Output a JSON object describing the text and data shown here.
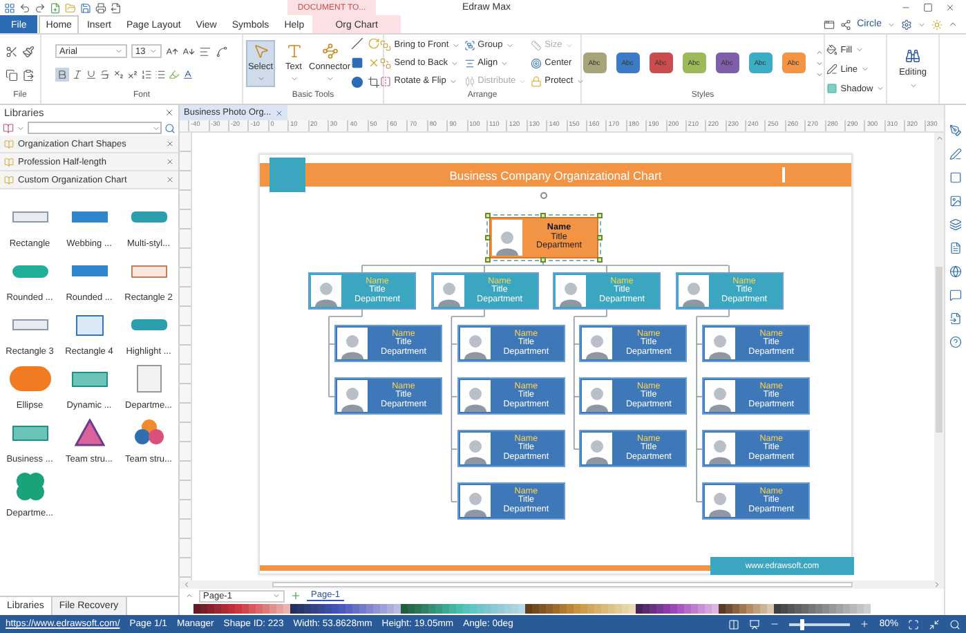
{
  "title_bar": {
    "context_label": "DOCUMENT TO...",
    "title": "Edraw Max"
  },
  "tabs": [
    {
      "label": "File",
      "kind": "file",
      "selected": false
    },
    {
      "label": "Home",
      "kind": "tab",
      "selected": true
    },
    {
      "label": "Insert",
      "kind": "tab",
      "selected": false
    },
    {
      "label": "Page Layout",
      "kind": "tab",
      "selected": false
    },
    {
      "label": "View",
      "kind": "tab",
      "selected": false
    },
    {
      "label": "Symbols",
      "kind": "tab",
      "selected": false
    },
    {
      "label": "Help",
      "kind": "tab",
      "selected": false
    },
    {
      "label": "Org Chart",
      "kind": "context",
      "selected": false
    }
  ],
  "account": {
    "label": "Circle"
  },
  "ribbon": {
    "file": {
      "label": "File"
    },
    "font": {
      "label": "Font",
      "family": "Arial",
      "size": "13",
      "bold": true
    },
    "tools": {
      "label": "Basic Tools",
      "items": [
        {
          "label": "Select",
          "selected": true
        },
        {
          "label": "Text",
          "selected": false
        },
        {
          "label": "Connector",
          "selected": false
        }
      ]
    },
    "arrange": {
      "label": "Arrange",
      "items": [
        {
          "label": "Bring to Front",
          "disabled": false,
          "menu": true
        },
        {
          "label": "Send to Back",
          "disabled": false,
          "menu": true
        },
        {
          "label": "Rotate & Flip",
          "disabled": false,
          "menu": true
        },
        {
          "label": "Group",
          "disabled": false,
          "menu": true
        },
        {
          "label": "Align",
          "disabled": false,
          "menu": true
        },
        {
          "label": "Distribute",
          "disabled": true,
          "menu": true
        },
        {
          "label": "Size",
          "disabled": true,
          "menu": true
        },
        {
          "label": "Center",
          "disabled": false,
          "menu": false
        },
        {
          "label": "Protect",
          "disabled": false,
          "menu": true
        }
      ]
    },
    "styles": {
      "label": "Styles",
      "items": [
        {
          "label": "Abc",
          "color": "#a8a47a"
        },
        {
          "label": "Abc",
          "color": "#3d7cc4"
        },
        {
          "label": "Abc",
          "color": "#c94d4d"
        },
        {
          "label": "Abc",
          "color": "#9cba5a"
        },
        {
          "label": "Abc",
          "color": "#7d60a9"
        },
        {
          "label": "Abc",
          "color": "#3badc5"
        },
        {
          "label": "Abc",
          "color": "#f29444"
        }
      ]
    },
    "format": [
      {
        "label": "Fill"
      },
      {
        "label": "Line"
      },
      {
        "label": "Shadow"
      }
    ],
    "editing": {
      "label": "Editing"
    }
  },
  "libraries": {
    "title": "Libraries",
    "categories": [
      {
        "label": "Organization Chart Shapes"
      },
      {
        "label": "Profession Half-length"
      },
      {
        "label": "Custom Organization Chart"
      }
    ],
    "shapes": [
      {
        "label": "Rectangle",
        "kind": "plain"
      },
      {
        "label": "Webbing ...",
        "kind": "blue"
      },
      {
        "label": "Multi-styl...",
        "kind": "teal"
      },
      {
        "label": "Rounded ...",
        "kind": "pill"
      },
      {
        "label": "Rounded ...",
        "kind": "blue"
      },
      {
        "label": "Rectangle 2",
        "kind": "peach"
      },
      {
        "label": "Rectangle 3",
        "kind": "plain"
      },
      {
        "label": "Rectangle 4",
        "kind": "card"
      },
      {
        "label": "Highlight ...",
        "kind": "teal"
      },
      {
        "label": "Ellipse",
        "kind": "ellipse"
      },
      {
        "label": "Dynamic ...",
        "kind": "table"
      },
      {
        "label": "Departme...",
        "kind": "sheet"
      },
      {
        "label": "Business ...",
        "kind": "table"
      },
      {
        "label": "Team stru...",
        "kind": "triangle"
      },
      {
        "label": "Team stru...",
        "kind": "circles"
      },
      {
        "label": "Departme...",
        "kind": "clover"
      }
    ],
    "bottom_tabs": [
      {
        "label": "Libraries",
        "selected": true
      },
      {
        "label": "File Recovery",
        "selected": false
      }
    ]
  },
  "document_tabs": [
    {
      "label": "Business Photo Org...",
      "selected": true
    }
  ],
  "ruler": {
    "labels": [
      "-40",
      "-30",
      "-20",
      "-10",
      "0",
      "10",
      "20",
      "30",
      "40",
      "50",
      "60",
      "70",
      "80",
      "90",
      "100",
      "110",
      "120",
      "130",
      "140",
      "150",
      "160",
      "170",
      "180",
      "190",
      "200",
      "210",
      "220",
      "230",
      "240",
      "250",
      "260",
      "270",
      "280",
      "290",
      "300",
      "310",
      "320",
      "330"
    ]
  },
  "chart": {
    "title": "Business Company Organizational Chart",
    "footer": "www.edrawsoft.com",
    "root": {
      "name": "Name",
      "title": "Title",
      "department": "Department",
      "selected": true,
      "children": [
        {
          "name": "Name",
          "title": "Title",
          "department": "Department",
          "selected": false,
          "children": [
            {
              "name": "Name",
              "title": "Title",
              "department": "Department",
              "selected": false
            },
            {
              "name": "Name",
              "title": "Title",
              "department": "Department",
              "selected": false
            }
          ]
        },
        {
          "name": "Name",
          "title": "Title",
          "department": "Department",
          "selected": false,
          "children": [
            {
              "name": "Name",
              "title": "Title",
              "department": "Department",
              "selected": false
            },
            {
              "name": "Name",
              "title": "Title",
              "department": "Department",
              "selected": false
            },
            {
              "name": "Name",
              "title": "Title",
              "department": "Department",
              "selected": false
            },
            {
              "name": "Name",
              "title": "Title",
              "department": "Department",
              "selected": false
            }
          ]
        },
        {
          "name": "Name",
          "title": "Title",
          "department": "Department",
          "selected": false,
          "children": [
            {
              "name": "Name",
              "title": "Title",
              "department": "Department",
              "selected": false
            },
            {
              "name": "Name",
              "title": "Title",
              "department": "Department",
              "selected": false
            },
            {
              "name": "Name",
              "title": "Title",
              "department": "Department",
              "selected": false
            }
          ]
        },
        {
          "name": "Name",
          "title": "Title",
          "department": "Department",
          "selected": false,
          "children": [
            {
              "name": "Name",
              "title": "Title",
              "department": "Department",
              "selected": false
            },
            {
              "name": "Name",
              "title": "Title",
              "department": "Department",
              "selected": false
            },
            {
              "name": "Name",
              "title": "Title",
              "department": "Department",
              "selected": false
            },
            {
              "name": "Name",
              "title": "Title",
              "department": "Department",
              "selected": false
            }
          ]
        }
      ]
    }
  },
  "page_tabs": {
    "menu": "Page-1",
    "tabs": [
      {
        "label": "Page-1",
        "selected": true
      }
    ]
  },
  "status_bar": {
    "url": "https://www.edrawsoft.com/",
    "items": [
      "Page 1/1",
      "Manager",
      "Shape ID: 223",
      "Width: 53.8628mm",
      "Height: 19.05mm",
      "Angle: 0deg"
    ],
    "zoom": {
      "level": 0.2,
      "label": "80%"
    }
  }
}
